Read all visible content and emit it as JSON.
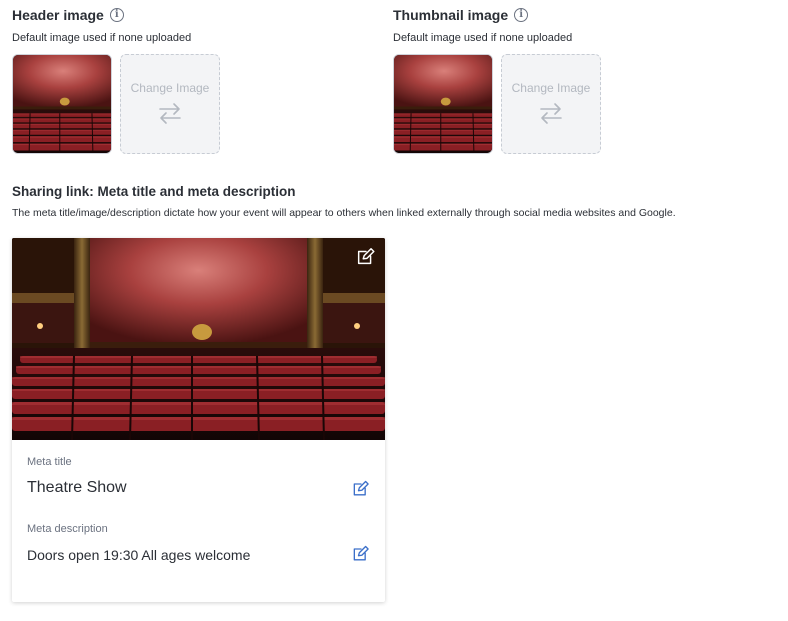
{
  "header_image": {
    "title": "Header image",
    "subtitle": "Default image used if none uploaded",
    "change_label": "Change Image"
  },
  "thumbnail_image": {
    "title": "Thumbnail image",
    "subtitle": "Default image used if none uploaded",
    "change_label": "Change Image"
  },
  "sharing": {
    "title": "Sharing link: Meta title and meta description",
    "description": "The meta title/image/description dictate how your event will appear to others when linked externally through social media websites and Google.",
    "meta_title_label": "Meta title",
    "meta_title_value": "Theatre Show",
    "meta_description_label": "Meta description",
    "meta_description_value": "Doors open 19:30 All ages welcome"
  },
  "icons": {
    "info": "info-icon",
    "swap": "swap-arrows-icon",
    "edit": "edit-pencil-icon"
  },
  "colors": {
    "accent": "#3b6fc9",
    "placeholder_bg": "#f3f4f6",
    "placeholder_text": "#b3b8c0",
    "curtain": "#b04a48",
    "seat": "#8a1f24"
  }
}
